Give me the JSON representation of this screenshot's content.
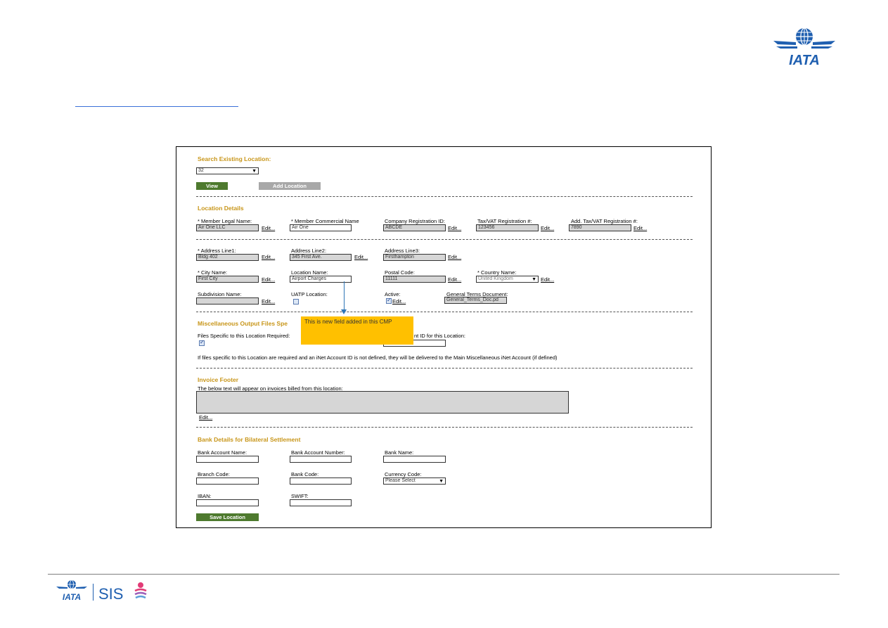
{
  "brand": {
    "top_logo_text": "IATA",
    "footer_iata": "IATA",
    "footer_sis": "SIS"
  },
  "search": {
    "title": "Search Existing Location:",
    "selected": "32",
    "view_label": "View",
    "add_label": "Add Location"
  },
  "location": {
    "title": "Location Details",
    "legal_name": {
      "label": "* Member Legal Name:",
      "value": "Air One LLC"
    },
    "commercial_name": {
      "label": "* Member Commercial Name",
      "value": "Air One"
    },
    "company_reg": {
      "label": "Company Registration ID:",
      "value": "ABCDE"
    },
    "tax_reg": {
      "label": "Tax/VAT Registration #:",
      "value": "123456"
    },
    "add_tax_reg": {
      "label": "Add. Tax/VAT Registration #:",
      "value": "7890"
    },
    "address1": {
      "label": "* Address Line1:",
      "value": "Bldg 402"
    },
    "address2": {
      "label": "Address Line2:",
      "value": "345 First Ave."
    },
    "address3": {
      "label": "Address Line3:",
      "value": "Firsthampton"
    },
    "city": {
      "label": "* City Name:",
      "value": "First City"
    },
    "location_name": {
      "label": "Location Name:",
      "value": "Airport Charges"
    },
    "postal": {
      "label": "Postal Code:",
      "value": "11111"
    },
    "country": {
      "label": "* Country Name:",
      "value": "United Kingdom"
    },
    "subdivision": {
      "label": "Subdivision Name:",
      "value": ""
    },
    "uatp": {
      "label": "UATP Location:"
    },
    "active": {
      "label": "Active:"
    },
    "terms": {
      "label": "General Terms Document:",
      "value": "General_Terms_Doc.pd"
    },
    "edit": "Edit..."
  },
  "callout": {
    "text": "This is new field added in this CMP"
  },
  "misc": {
    "title": "Miscellaneous Output Files Spe",
    "files_label": "Files Specific to this Location Required:",
    "inet_label": "nt ID for this Location:",
    "note": "If files specific to this Location are required and an iNet Account ID is not defined, they will be delivered to the Main Miscellaneous iNet Account (if defined)"
  },
  "invoice": {
    "title": "Invoice Footer",
    "desc": "The below text will appear on invoices billed from this location:",
    "edit": "Edit..."
  },
  "bank": {
    "title": "Bank Details for Bilateral Settlement",
    "account_name": "Bank Account Name:",
    "account_number": "Bank Account Number:",
    "bank_name": "Bank Name:",
    "branch_code": "Branch Code:",
    "bank_code": "Bank Code:",
    "currency_code": "Currency Code:",
    "currency_value": "Please Select",
    "iban": "IBAN:",
    "swift": "SWIFT:",
    "save_label": "Save Location"
  },
  "colors": {
    "accent": "#c8961a",
    "button_green": "#4e7a2e",
    "callout": "#ffc000",
    "iata_blue": "#1f5fb0"
  }
}
